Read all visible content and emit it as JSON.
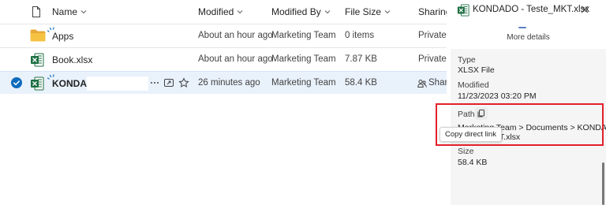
{
  "list": {
    "headers": {
      "name": "Name",
      "modified": "Modified",
      "modified_by": "Modified By",
      "file_size": "File Size",
      "sharing": "Sharing"
    },
    "rows": [
      {
        "name": "Apps",
        "modified": "About an hour ago",
        "modified_by": "Marketing Team",
        "file_size": "0 items",
        "sharing": "Private",
        "icon": "folder-icon"
      },
      {
        "name": "Book.xlsx",
        "modified": "About an hour ago",
        "modified_by": "Marketing Team",
        "file_size": "7.87 KB",
        "sharing": "Private",
        "icon": "excel-file-icon"
      },
      {
        "name": "KONDADO",
        "modified": "26 minutes ago",
        "modified_by": "Marketing Team",
        "file_size": "58.4 KB",
        "sharing": "Share",
        "icon": "excel-file-icon",
        "selected": true
      }
    ]
  },
  "details": {
    "title": "KONDADO - Teste_MKT.xlsx",
    "more_details": "More details",
    "type_label": "Type",
    "type_value": "XLSX File",
    "modified_label": "Modified",
    "modified_value": "11/23/2023 03:20 PM",
    "path_label": "Path",
    "path_line1": "Marketing Team > Documents > KONDADO",
    "path_line2": "- Teste_MKT.xlsx",
    "size_label": "Size",
    "size_value": "58.4 KB",
    "tooltip": "Copy direct link"
  },
  "colors": {
    "accent": "#0f6cbd",
    "selected_row": "#e9f1fb",
    "highlight_box": "#e2202a",
    "excel_green": "#1d6f42",
    "folder_yellow": "#f5c242"
  }
}
